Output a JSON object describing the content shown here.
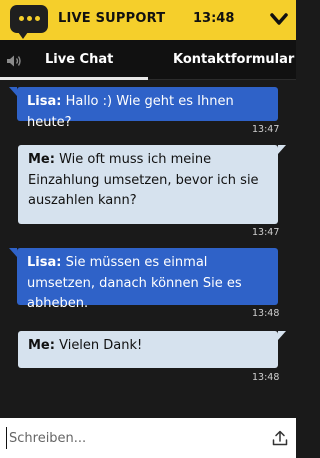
{
  "header": {
    "title": "LIVE SUPPORT",
    "time": "13:48",
    "chat_icon": "chat-bubble-icon",
    "collapse_icon": "chevron-down-icon",
    "accent_color": "#f5cf2b"
  },
  "tabs": {
    "sound_icon": "speaker-icon",
    "live_chat": "Live Chat",
    "kontakt": "Kontaktformular",
    "active": "Live Chat"
  },
  "messages": [
    {
      "role": "agent",
      "sender": "Lisa:",
      "text": "Hallo :) Wie geht es Ihnen heute?",
      "time": "13:47"
    },
    {
      "role": "user",
      "sender": "Me:",
      "text": "Wie oft muss ich meine Einzahlung umsetzen, bevor ich sie auszahlen kann?",
      "time": "13:47"
    },
    {
      "role": "agent",
      "sender": "Lisa:",
      "text": "Sie müssen es einmal umsetzen, danach können Sie es abheben.",
      "time": "13:48"
    },
    {
      "role": "user",
      "sender": "Me:",
      "text": "Vielen Dank!",
      "time": "13:48"
    }
  ],
  "composer": {
    "placeholder": "Schreiben...",
    "value": "",
    "upload_icon": "upload-icon"
  }
}
